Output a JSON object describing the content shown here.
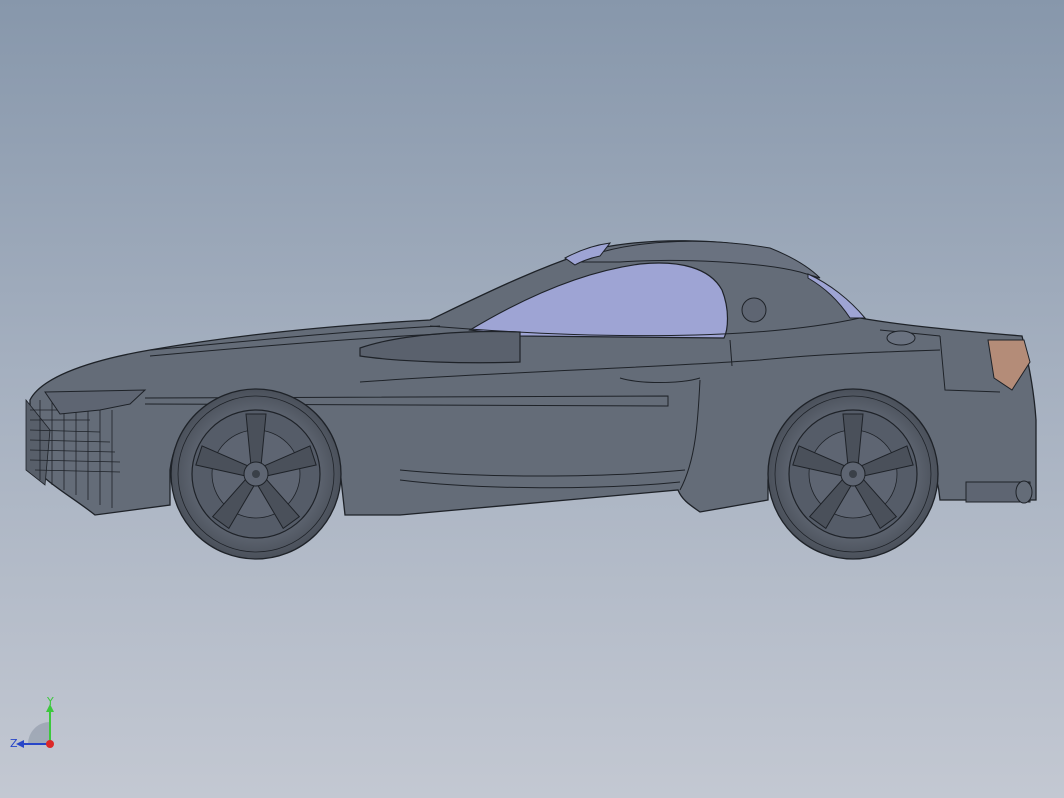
{
  "viewport": {
    "background_top": "#8797ab",
    "background_bottom": "#c3c8d2"
  },
  "model": {
    "body_color": "#646c78",
    "edge_color": "#1e2228",
    "glass_color": "#9ea4d4",
    "taillight_color": "#b48c78"
  },
  "triad": {
    "y_label": "Y",
    "z_label": "Z",
    "y_color": "#3cc83c",
    "z_color": "#2846c8",
    "x_color": "#dc2828"
  }
}
